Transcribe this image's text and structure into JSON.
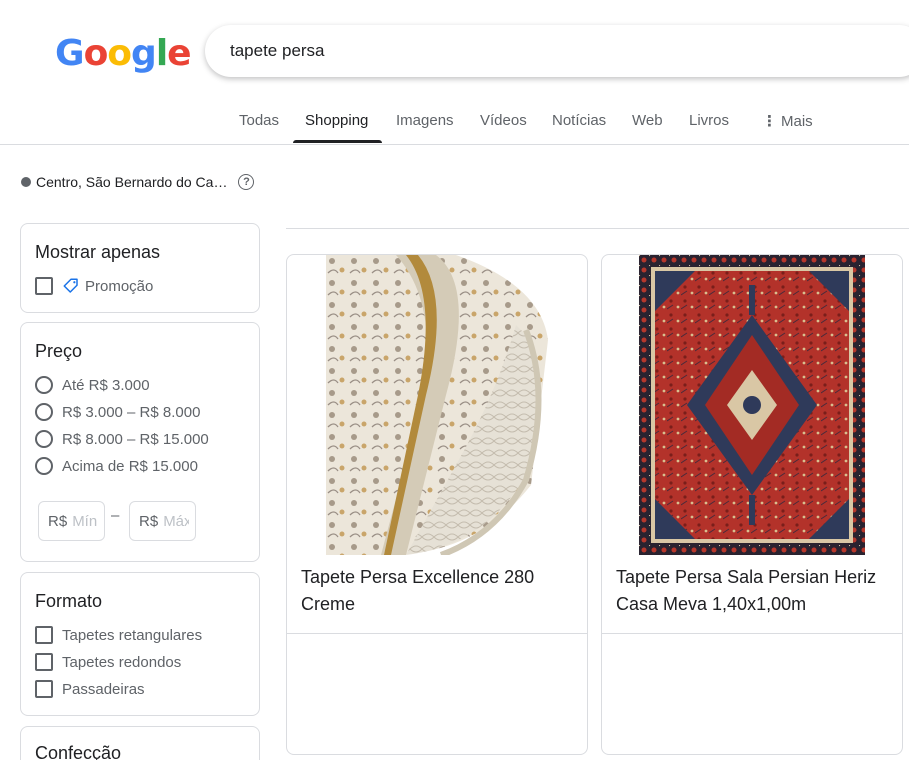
{
  "logo": {
    "letters": [
      "G",
      "o",
      "o",
      "g",
      "l",
      "e"
    ],
    "colors": [
      "#4285F4",
      "#EA4335",
      "#FBBC05",
      "#4285F4",
      "#34A853",
      "#EA4335"
    ]
  },
  "search": {
    "query": "tapete persa"
  },
  "tabs": [
    {
      "label": "Todas"
    },
    {
      "label": "Shopping"
    },
    {
      "label": "Imagens"
    },
    {
      "label": "Vídeos"
    },
    {
      "label": "Notícias"
    },
    {
      "label": "Web"
    },
    {
      "label": "Livros"
    },
    {
      "label": "Mais"
    }
  ],
  "active_tab": "Shopping",
  "location": {
    "text": "Centro, São Bernardo do Ca…",
    "help_icon": "?"
  },
  "filters": {
    "show_only": {
      "title": "Mostrar apenas",
      "option": "Promoção",
      "icon": "tag-icon"
    },
    "price": {
      "title": "Preço",
      "options": [
        "Até R$ 3.000",
        "R$ 3.000 – R$ 8.000",
        "R$ 8.000 – R$ 15.000",
        "Acima de R$ 15.000"
      ],
      "currency": "R$",
      "min_placeholder": "Mín",
      "max_placeholder": "Máx",
      "dash": "–"
    },
    "format": {
      "title": "Formato",
      "options": [
        "Tapetes retangulares",
        "Tapetes redondos",
        "Passadeiras"
      ]
    },
    "confeccao": {
      "title": "Confecção"
    }
  },
  "products": [
    {
      "title": "Tapete Persa Excellence 280 Creme",
      "image": "cream-rolled-persian-rug"
    },
    {
      "title": "Tapete Persa Sala Persian Heriz Casa Meva 1,40x1,00m",
      "image": "red-heriz-persian-rug"
    }
  ],
  "colors": {
    "accent": "#202124",
    "muted": "#5f6368",
    "border": "#dadce0"
  }
}
